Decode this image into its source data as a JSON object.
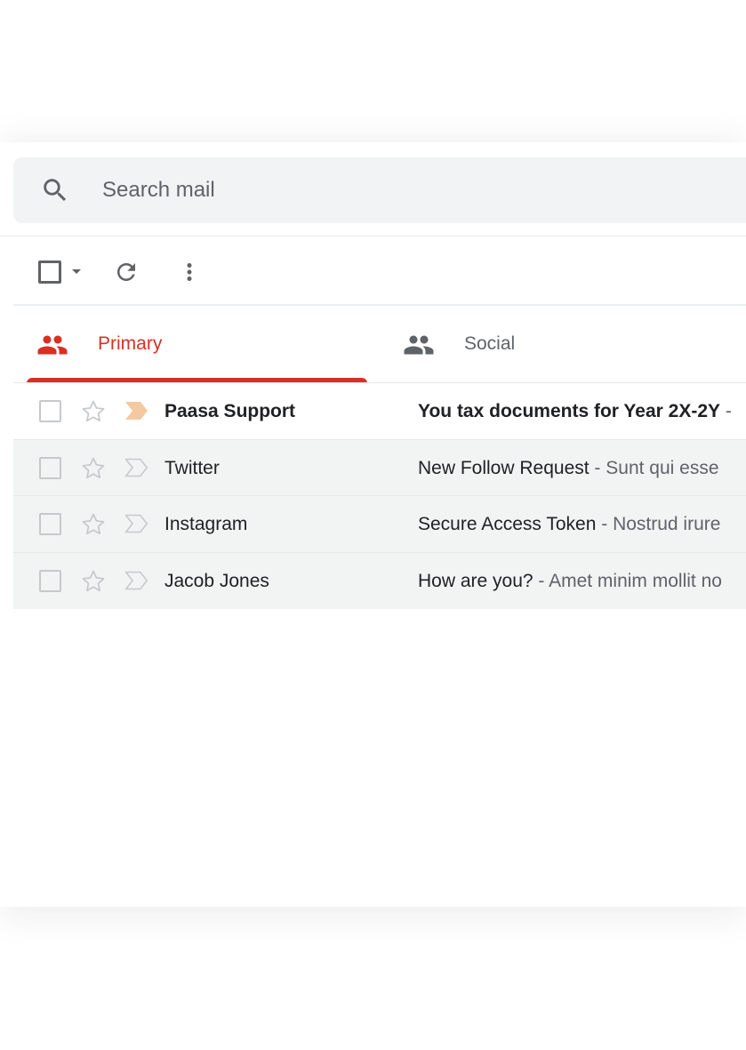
{
  "search": {
    "placeholder": "Search mail",
    "icon": "search-icon"
  },
  "toolbar": {
    "select_all_icon": "checkbox-icon",
    "select_menu_icon": "caret-down-icon",
    "refresh_icon": "refresh-icon",
    "more_icon": "more-vert-icon"
  },
  "tabs": [
    {
      "label": "Primary",
      "icon": "people-icon",
      "active": true,
      "color": "#d93025"
    },
    {
      "label": "Social",
      "icon": "people-icon",
      "active": false,
      "color": "#5f6368"
    }
  ],
  "emails": [
    {
      "sender": "Paasa Support",
      "subject": "You tax documents for Year 2X-2Y",
      "snippet": " -",
      "unread": true,
      "important": true
    },
    {
      "sender": "Twitter",
      "subject": "New Follow Request",
      "snippet": " - Sunt qui esse",
      "unread": false,
      "important": false
    },
    {
      "sender": "Instagram",
      "subject": "Secure Access Token",
      "snippet": " - Nostrud irure",
      "unread": false,
      "important": false
    },
    {
      "sender": "Jacob Jones",
      "subject": "How are you?",
      "snippet": " - Amet minim mollit no",
      "unread": false,
      "important": false
    }
  ],
  "colors": {
    "accent": "#d93025",
    "important_marker": "#f5c8a0",
    "search_background": "#f1f3f4",
    "read_row_background": "#f2f4f4"
  }
}
